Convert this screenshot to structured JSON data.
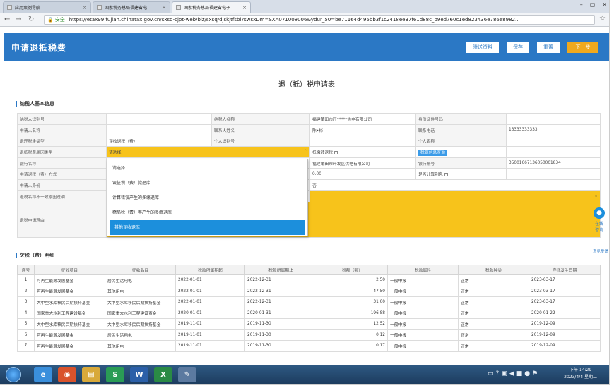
{
  "browser": {
    "tabs": [
      {
        "label": "应用案例导航"
      },
      {
        "label": "国家税务总局福建省电"
      },
      {
        "label": "国家税务总局福建省电子"
      }
    ],
    "secure_label": "安全",
    "url": "https://etax99.fujian.chinatax.gov.cn/sxsq-cjpt-web/biz/sxsq/djskjtfsbl?swsxDm=SXA071008006&ydur_50=be71164d495bb3f1c2418ee37f61d88c_b9ed760c1ed823436e786e8982..."
  },
  "header": {
    "title": "申请退抵税费",
    "buttons": [
      {
        "label": "附送资料"
      },
      {
        "label": "保存"
      },
      {
        "label": "重置"
      },
      {
        "label": "下一步"
      }
    ]
  },
  "form": {
    "title": "退（抵）税申请表",
    "section1": "纳税人基本信息",
    "rows": [
      [
        "纳税人识别号",
        "",
        "纳税人名称",
        "福建莆田市开*****供电有限公司",
        "身份证件号码",
        ""
      ],
      [
        "申请人名称",
        "",
        "联系人姓名",
        "陈•彬",
        "联系电话",
        "13333333333"
      ],
      [
        "退还税金类型",
        "误收退税（费）",
        "个人识别号",
        "",
        "个人名称",
        ""
      ],
      [
        "退抵税费原因类型",
        "请选择",
        "抵缴转退税",
        "",
        "税源信息查询",
        ""
      ],
      [
        "银行名称",
        "",
        "福建莆田市开发区供电有限公司",
        "",
        "银行账号",
        "35001667136050001834"
      ],
      [
        "申请退税（费）方式",
        "",
        "0.00",
        "",
        "是否计算利息",
        ""
      ],
      [
        "申请人身份",
        "",
        "否",
        "",
        "",
        ""
      ],
      [
        "退税名称不一致原因说明",
        "",
        "",
        "",
        "",
        ""
      ],
      [
        "退税申请理由",
        "",
        "",
        "",
        "",
        ""
      ]
    ],
    "dropdown": {
      "options": [
        "请选择",
        "误征税（费）款退库",
        "计算错误产生的多缴退库",
        "稽局税（费）率产生的多缴退库",
        "其他误收退库"
      ],
      "highlighted_index": 4
    },
    "section2": "欠税（费）明细",
    "detail_columns": [
      "序号",
      "征收项目",
      "征收品目",
      "税款所属期起",
      "税款所属期止",
      "税额（额）",
      "税款属性",
      "税款种类",
      "应征发生日期"
    ],
    "detail_rows": [
      [
        "1",
        "可再生能源发展基金",
        "居民生活用电",
        "2022-01-01",
        "2022-12-31",
        "2.50",
        "一般申报",
        "正常",
        "2023-03-17"
      ],
      [
        "2",
        "可再生能源发展基金",
        "其他用电",
        "2022-01-01",
        "2022-12-31",
        "47.50",
        "一般申报",
        "正常",
        "2023-03-17"
      ],
      [
        "3",
        "大中型水库移民后期扶持基金",
        "大中型水库移民后期扶持基金",
        "2022-01-01",
        "2022-12-31",
        "31.00",
        "一般申报",
        "正常",
        "2023-03-17"
      ],
      [
        "4",
        "国家重大水利工程建设基金",
        "国家重大水利工程建设资金",
        "2020-01-01",
        "2020-01-31",
        "196.88",
        "一般申报",
        "正常",
        "2020-01-22"
      ],
      [
        "5",
        "大中型水库移民后期扶持基金",
        "大中型水库移民后期扶持基金",
        "2019-11-01",
        "2019-11-30",
        "12.52",
        "一般申报",
        "正常",
        "2019-12-09"
      ],
      [
        "6",
        "可再生能源发展基金",
        "居民生活用电",
        "2019-11-01",
        "2019-11-30",
        "0.12",
        "一般申报",
        "正常",
        "2019-12-09"
      ],
      [
        "7",
        "可再生能源发展基金",
        "其他用电",
        "2019-11-01",
        "2019-11-30",
        "0.17",
        "一般申报",
        "正常",
        "2019-12-09"
      ]
    ]
  },
  "chat_widget": {
    "line1": "在线",
    "line2": "咨询",
    "feedback": "意见反馈"
  },
  "taskbar": {
    "icons": [
      {
        "name": "ie-icon",
        "label": "e",
        "color": "#3a8fdc"
      },
      {
        "name": "chrome-icon",
        "label": "◉",
        "color": "#d9532c"
      },
      {
        "name": "folder-icon",
        "label": "▤",
        "color": "#d8a93a"
      },
      {
        "name": "app-s-icon",
        "label": "S",
        "color": "#2a9c55"
      },
      {
        "name": "word-icon",
        "label": "W",
        "color": "#2b5fa8"
      },
      {
        "name": "excel-icon",
        "label": "X",
        "color": "#2a8a45"
      },
      {
        "name": "paint-icon",
        "label": "✎",
        "color": "#5c7aa0"
      }
    ],
    "time": "下午 14:29",
    "date": "2023/4/4 星期二"
  }
}
